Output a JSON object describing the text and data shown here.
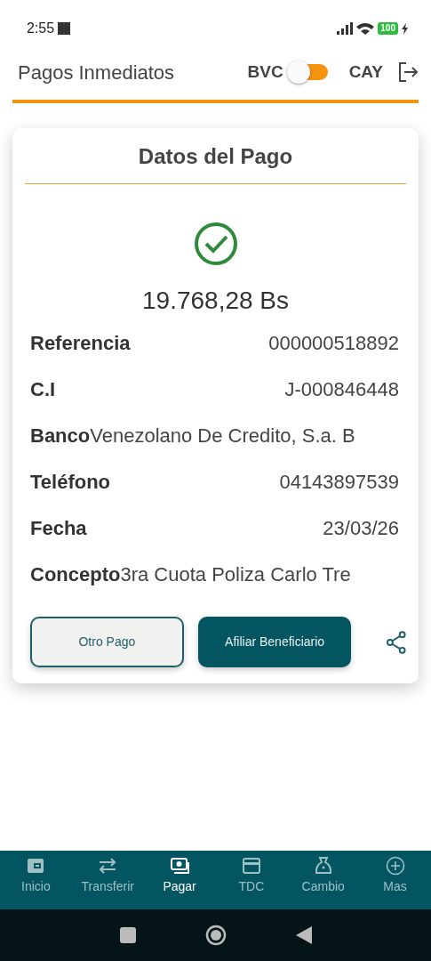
{
  "status_bar": {
    "time": "2:55",
    "battery": "100"
  },
  "header": {
    "title": "Pagos Inmediatos",
    "switch": {
      "left_label": "BVC",
      "right_label": "CAY",
      "on": false
    }
  },
  "card": {
    "title": "Datos del Pago",
    "amount": "19.768,28 Bs",
    "fields": [
      {
        "label": "Referencia",
        "value": "000000518892",
        "kind": "split"
      },
      {
        "label": "C.I",
        "value": "J-000846448",
        "kind": "split"
      },
      {
        "label": "Banco",
        "value": "Venezolano De Credito, S.a. B",
        "kind": "joined"
      },
      {
        "label": "Teléfono",
        "value": "04143897539",
        "kind": "split"
      },
      {
        "label": "Fecha",
        "value": "23/03/26",
        "kind": "split"
      },
      {
        "label": "Concepto",
        "value": "3ra Cuota Poliza Carlo Tre",
        "kind": "joined"
      }
    ],
    "buttons": [
      {
        "label": "Otro Pago",
        "kind": "outline"
      },
      {
        "label": "Afiliar Beneficiario",
        "kind": "filled"
      }
    ]
  },
  "bottom_nav": [
    {
      "label": "Inicio",
      "kind": "wallet",
      "selected": false
    },
    {
      "label": "Transferir",
      "kind": "arrows",
      "selected": false
    },
    {
      "label": "Pagar",
      "kind": "cash",
      "selected": true
    },
    {
      "label": "TDC",
      "kind": "card",
      "selected": false
    },
    {
      "label": "Cambio",
      "kind": "bag",
      "selected": false
    },
    {
      "label": "Mas",
      "kind": "plus",
      "selected": false
    }
  ]
}
